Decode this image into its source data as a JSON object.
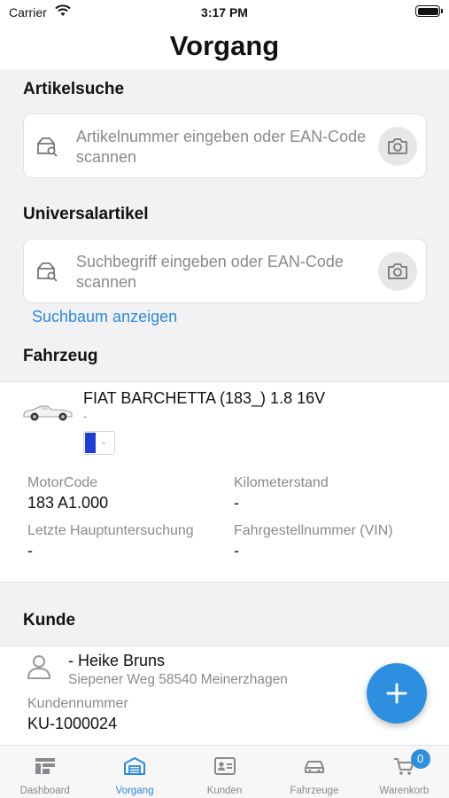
{
  "statusbar": {
    "carrier": "Carrier",
    "time": "3:17 PM"
  },
  "navbar": {
    "title": "Vorgang"
  },
  "article_search": {
    "heading": "Artikelsuche",
    "placeholder": "Artikelnummer eingeben oder EAN-Code scannen"
  },
  "universal_article": {
    "heading": "Universalartikel",
    "placeholder": "Suchbegriff eingeben oder EAN-Code scannen",
    "link": "Suchbaum anzeigen"
  },
  "vehicle": {
    "heading": "Fahrzeug",
    "name": "FIAT BARCHETTA (183_) 1.8 16V",
    "sub": "-",
    "plate": "-",
    "fields": {
      "motor_code_label": "MotorCode",
      "motor_code_value": "183 A1.000",
      "km_label": "Kilometerstand",
      "km_value": "-",
      "hu_label": "Letzte Hauptuntersuchung",
      "hu_value": "-",
      "vin_label": "Fahrgestellnummer (VIN)",
      "vin_value": "-"
    }
  },
  "customer": {
    "heading": "Kunde",
    "name": "- Heike Bruns",
    "address": "Siepener Weg 58540 Meinerzhagen",
    "number_label": "Kundennummer",
    "number_value": "KU-1000024"
  },
  "fab": {
    "icon": "plus-icon"
  },
  "tabs": [
    {
      "label": "Dashboard",
      "icon": "dashboard-icon",
      "active": false
    },
    {
      "label": "Vorgang",
      "icon": "vorgang-icon",
      "active": true
    },
    {
      "label": "Kunden",
      "icon": "contact-card-icon",
      "active": false
    },
    {
      "label": "Fahrzeuge",
      "icon": "car-icon",
      "active": false
    },
    {
      "label": "Warenkorb",
      "icon": "cart-icon",
      "active": false,
      "badge": "0"
    }
  ],
  "colors": {
    "accent": "#2d8fe0",
    "link": "#2a8ad8",
    "background": "#f2f2f4"
  }
}
